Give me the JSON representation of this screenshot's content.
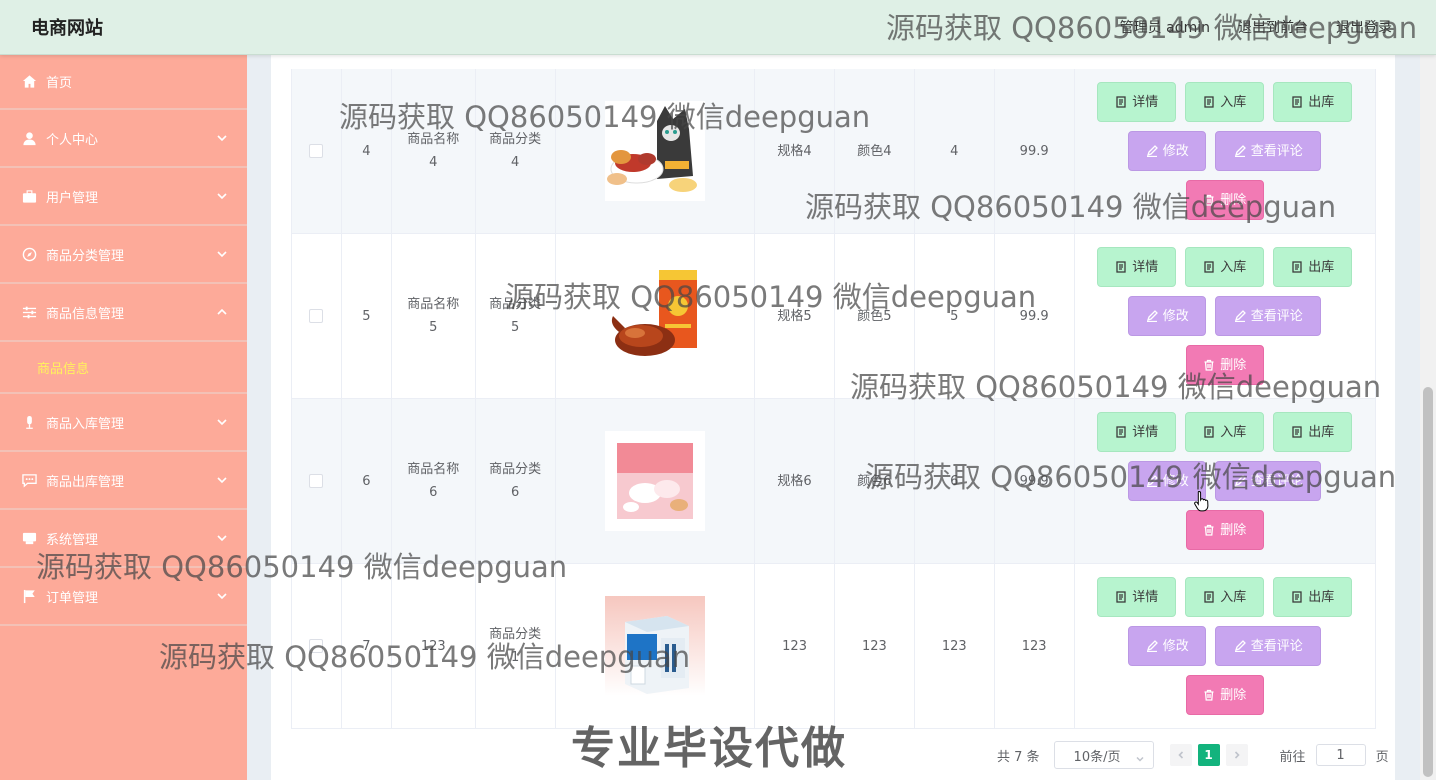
{
  "header": {
    "site_title": "电商网站",
    "user_label": "管理员 admin",
    "front_link": "退出到前台",
    "logout_link": "退出登录"
  },
  "sidebar": {
    "items": [
      {
        "label": "首页",
        "icon": "home-icon"
      },
      {
        "label": "个人中心",
        "icon": "user-icon"
      },
      {
        "label": "用户管理",
        "icon": "briefcase-icon"
      },
      {
        "label": "商品分类管理",
        "icon": "compass-icon"
      },
      {
        "label": "商品信息管理",
        "icon": "sliders-icon"
      },
      {
        "label": "商品入库管理",
        "icon": "microphone-icon"
      },
      {
        "label": "商品出库管理",
        "icon": "chat-icon"
      },
      {
        "label": "系统管理",
        "icon": "printer-icon"
      },
      {
        "label": "订单管理",
        "icon": "flag-icon"
      }
    ],
    "active_sub": "商品信息"
  },
  "table": {
    "rows": [
      {
        "id": "4",
        "name": "商品名称\n4",
        "category": "商品分类\n4",
        "spec": "规格4",
        "color": "颜色4",
        "stock": "4",
        "price": "99.9",
        "image": "snacks-image"
      },
      {
        "id": "5",
        "name": "商品名称\n5",
        "category": "商品分类\n5",
        "spec": "规格5",
        "color": "颜色5",
        "stock": "5",
        "price": "99.9",
        "image": "roast-duck-image"
      },
      {
        "id": "6",
        "name": "商品名称\n6",
        "category": "商品分类\n6",
        "spec": "规格6",
        "color": "颜色6",
        "stock": "6",
        "price": "99.9",
        "image": "pink-snack-image"
      },
      {
        "id": "7",
        "name": "123",
        "category": "商品分类\n1",
        "spec": "123",
        "color": "123",
        "stock": "123",
        "price": "123",
        "image": "milk-box-image"
      }
    ],
    "actions": {
      "detail": "详情",
      "stock_in": "入库",
      "stock_out": "出库",
      "edit": "修改",
      "review": "查看评论",
      "delete": "删除"
    }
  },
  "pagination": {
    "total": "共 7 条",
    "page_size": "10条/页",
    "current": "1",
    "goto_prefix": "前往",
    "goto_value": "1",
    "goto_suffix": "页"
  },
  "watermark": {
    "text": "源码获取 QQ86050149 微信deepguan",
    "bottom_text": "专业毕设代做"
  },
  "colors": {
    "header_bg": "#dff0e6",
    "sidebar_bg": "#fdaa99",
    "active_sub": "#fff35c",
    "btn_green": "#b7f4cf",
    "btn_purple": "#c8a5ef",
    "btn_pink": "#f27ab4",
    "page_active": "#13b37d"
  }
}
